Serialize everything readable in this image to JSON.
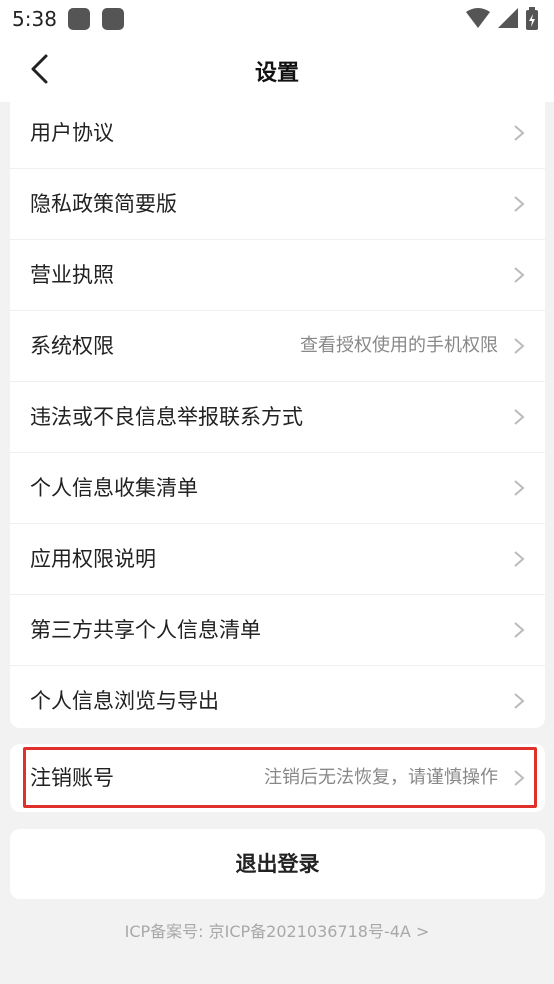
{
  "status_bar": {
    "time": "5:38",
    "icons": [
      "app-square-icon",
      "app-square-icon",
      "wifi-icon",
      "signal-icon",
      "battery-charging-icon"
    ]
  },
  "header": {
    "title": "设置",
    "back_icon": "chevron-left-icon"
  },
  "settings_list": [
    {
      "label": "用户协议",
      "value": ""
    },
    {
      "label": "隐私政策简要版",
      "value": ""
    },
    {
      "label": "营业执照",
      "value": ""
    },
    {
      "label": "系统权限",
      "value": "查看授权使用的手机权限"
    },
    {
      "label": "违法或不良信息举报联系方式",
      "value": ""
    },
    {
      "label": "个人信息收集清单",
      "value": ""
    },
    {
      "label": "应用权限说明",
      "value": ""
    },
    {
      "label": "第三方共享个人信息清单",
      "value": ""
    },
    {
      "label": "个人信息浏览与导出",
      "value": ""
    }
  ],
  "cancel_account": {
    "label": "注销账号",
    "value": "注销后无法恢复，请谨慎操作"
  },
  "logout": {
    "label": "退出登录"
  },
  "footer": {
    "icp": "ICP备案号: 京ICP备2021036718号-4A >"
  },
  "colors": {
    "background": "#f2f2f2",
    "card": "#ffffff",
    "highlight": "#e0302a",
    "muted_text": "#888888",
    "chevron": "#bbbbbb"
  }
}
